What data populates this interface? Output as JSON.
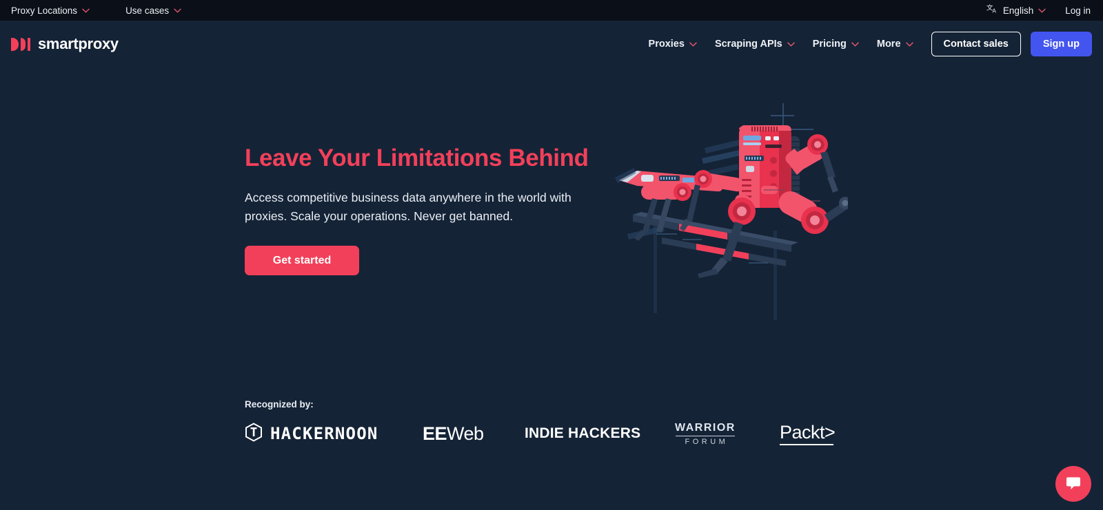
{
  "colors": {
    "page_bg": "#152336",
    "utilbar_bg": "#0a0f18",
    "accent_pink": "#f2405a",
    "accent_blue": "#4355ef",
    "text_light": "#eef2f7"
  },
  "utilbar": {
    "left_items": [
      {
        "label": "Proxy Locations",
        "icon": "chevron-down-icon"
      },
      {
        "label": "Use cases",
        "icon": "chevron-down-icon"
      }
    ],
    "language": {
      "icon": "translate-icon",
      "label": "English",
      "chevron": "chevron-down-icon"
    },
    "login_label": "Log in"
  },
  "header": {
    "logo": {
      "text": "smartproxy",
      "mark": "smartproxy-logo-mark"
    },
    "nav_items": [
      {
        "label": "Proxies",
        "icon": "chevron-down-icon"
      },
      {
        "label": "Scraping APIs",
        "icon": "chevron-down-icon"
      },
      {
        "label": "Pricing",
        "icon": "chevron-down-icon"
      },
      {
        "label": "More",
        "icon": "chevron-down-icon"
      }
    ],
    "contact_label": "Contact sales",
    "signup_label": "Sign up"
  },
  "hero": {
    "title": "Leave Your Limitations Behind",
    "subtitle": "Access competitive business data anywhere in the world with proxies. Scale your operations. Never get banned.",
    "cta_label": "Get started",
    "illustration": "robot-dog-jumping-hurdle-illustration"
  },
  "recognized": {
    "label": "Recognized by:",
    "logos": [
      {
        "name": "hackernoon-logo",
        "text": "HACKERNOON",
        "icon": "hackernoon-hex-icon"
      },
      {
        "name": "eeweb-logo",
        "text_bold": "EE",
        "text_light": "Web"
      },
      {
        "name": "indie-hackers-logo",
        "text": "INDIE HACKERS"
      },
      {
        "name": "warrior-forum-logo",
        "text_top": "WARRIOR",
        "text_bottom": "FORUM"
      },
      {
        "name": "packt-logo",
        "text": "Packt>"
      }
    ]
  },
  "chat": {
    "icon": "chat-bubble-icon",
    "label": "Open chat"
  }
}
